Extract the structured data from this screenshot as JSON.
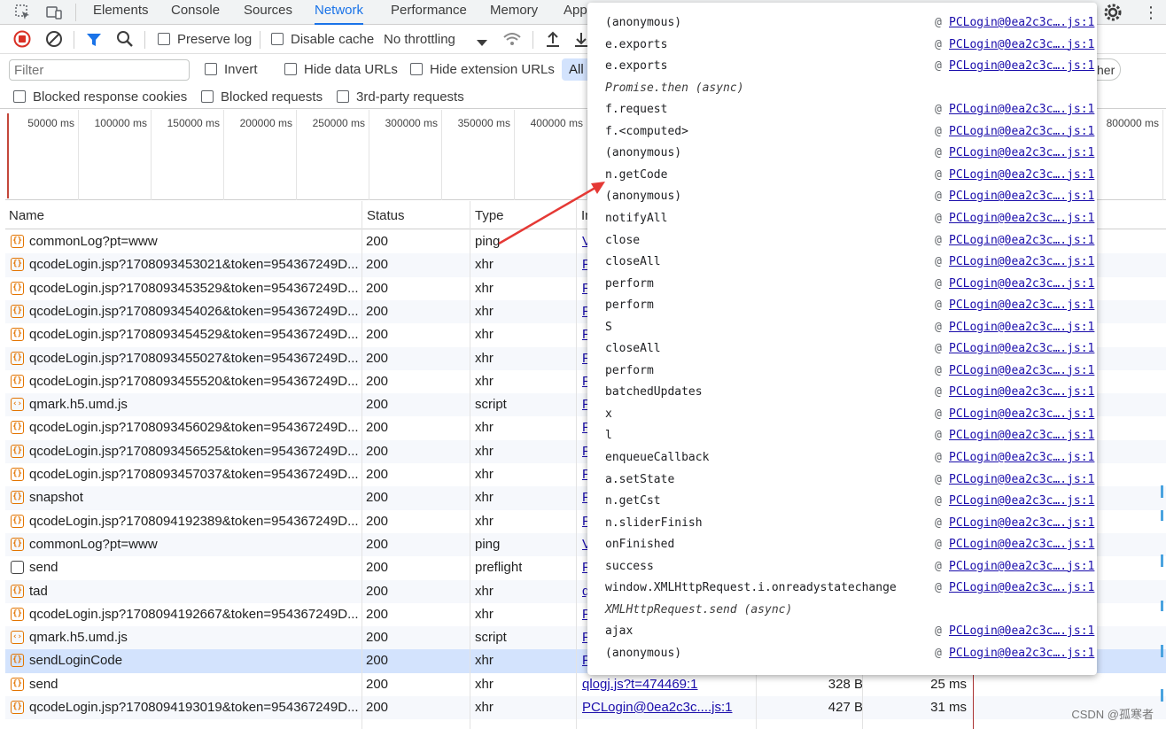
{
  "tabs": [
    {
      "label": "Elements",
      "active": false
    },
    {
      "label": "Console",
      "active": false
    },
    {
      "label": "Sources",
      "active": false
    },
    {
      "label": "Network",
      "active": true
    },
    {
      "label": "Performance",
      "active": false
    },
    {
      "label": "Memory",
      "active": false
    },
    {
      "label": "App",
      "active": false
    }
  ],
  "toolbar": {
    "preserve_log": "Preserve log",
    "disable_cache": "Disable cache",
    "throttling": "No throttling"
  },
  "filter": {
    "placeholder": "Filter",
    "invert": "Invert",
    "hide_data_urls": "Hide data URLs",
    "hide_extension_urls": "Hide extension URLs",
    "all": "All",
    "other_partial": "her"
  },
  "filter2": {
    "blocked_cookies": "Blocked response cookies",
    "blocked_requests": "Blocked requests",
    "third_party": "3rd-party requests"
  },
  "overview_ticks": [
    "50000 ms",
    "100000 ms",
    "150000 ms",
    "200000 ms",
    "250000 ms",
    "300000 ms",
    "350000 ms",
    "400000 ms",
    "800000 ms"
  ],
  "table": {
    "headers": {
      "name": "Name",
      "status": "Status",
      "type": "Type",
      "initiator": "In"
    },
    "rows": [
      {
        "icon": "xhr",
        "name": "commonLog?pt=www",
        "status": "200",
        "type": "ping",
        "initiator": "V",
        "size": "",
        "time": "",
        "alt": false,
        "sel": false
      },
      {
        "icon": "xhr",
        "name": "qcodeLogin.jsp?1708093453021&token=954367249D...",
        "status": "200",
        "type": "xhr",
        "initiator": "P",
        "size": "",
        "time": "",
        "alt": true,
        "sel": false
      },
      {
        "icon": "xhr",
        "name": "qcodeLogin.jsp?1708093453529&token=954367249D...",
        "status": "200",
        "type": "xhr",
        "initiator": "P",
        "size": "",
        "time": "",
        "alt": false,
        "sel": false
      },
      {
        "icon": "xhr",
        "name": "qcodeLogin.jsp?1708093454026&token=954367249D...",
        "status": "200",
        "type": "xhr",
        "initiator": "P",
        "size": "",
        "time": "",
        "alt": true,
        "sel": false
      },
      {
        "icon": "xhr",
        "name": "qcodeLogin.jsp?1708093454529&token=954367249D...",
        "status": "200",
        "type": "xhr",
        "initiator": "P",
        "size": "",
        "time": "",
        "alt": false,
        "sel": false
      },
      {
        "icon": "xhr",
        "name": "qcodeLogin.jsp?1708093455027&token=954367249D...",
        "status": "200",
        "type": "xhr",
        "initiator": "P",
        "size": "",
        "time": "",
        "alt": true,
        "sel": false
      },
      {
        "icon": "xhr",
        "name": "qcodeLogin.jsp?1708093455520&token=954367249D...",
        "status": "200",
        "type": "xhr",
        "initiator": "P",
        "size": "",
        "time": "",
        "alt": false,
        "sel": false
      },
      {
        "icon": "script",
        "name": "qmark.h5.umd.js",
        "status": "200",
        "type": "script",
        "initiator": "P",
        "size": "",
        "time": "",
        "alt": true,
        "sel": false
      },
      {
        "icon": "xhr",
        "name": "qcodeLogin.jsp?1708093456029&token=954367249D...",
        "status": "200",
        "type": "xhr",
        "initiator": "P",
        "size": "",
        "time": "",
        "alt": false,
        "sel": false
      },
      {
        "icon": "xhr",
        "name": "qcodeLogin.jsp?1708093456525&token=954367249D...",
        "status": "200",
        "type": "xhr",
        "initiator": "P",
        "size": "",
        "time": "",
        "alt": true,
        "sel": false
      },
      {
        "icon": "xhr",
        "name": "qcodeLogin.jsp?1708093457037&token=954367249D...",
        "status": "200",
        "type": "xhr",
        "initiator": "P",
        "size": "",
        "time": "",
        "alt": false,
        "sel": false
      },
      {
        "icon": "xhr",
        "name": "snapshot",
        "status": "200",
        "type": "xhr",
        "initiator": "P",
        "size": "",
        "time": "",
        "alt": true,
        "sel": false
      },
      {
        "icon": "xhr",
        "name": "qcodeLogin.jsp?1708094192389&token=954367249D...",
        "status": "200",
        "type": "xhr",
        "initiator": "P",
        "size": "",
        "time": "",
        "alt": false,
        "sel": false
      },
      {
        "icon": "xhr",
        "name": "commonLog?pt=www",
        "status": "200",
        "type": "ping",
        "initiator": "V",
        "size": "",
        "time": "",
        "alt": true,
        "sel": false
      },
      {
        "icon": "doc",
        "name": "send",
        "status": "200",
        "type": "preflight",
        "initiator": "P",
        "size": "",
        "time": "",
        "alt": false,
        "sel": false
      },
      {
        "icon": "xhr",
        "name": "tad",
        "status": "200",
        "type": "xhr",
        "initiator": "q",
        "size": "",
        "time": "",
        "alt": true,
        "sel": false
      },
      {
        "icon": "xhr",
        "name": "qcodeLogin.jsp?1708094192667&token=954367249D...",
        "status": "200",
        "type": "xhr",
        "initiator": "P",
        "size": "",
        "time": "",
        "alt": false,
        "sel": false
      },
      {
        "icon": "script",
        "name": "qmark.h5.umd.js",
        "status": "200",
        "type": "script",
        "initiator": "P",
        "size": "",
        "time": "",
        "alt": true,
        "sel": false
      },
      {
        "icon": "xhr",
        "name": "sendLoginCode",
        "status": "200",
        "type": "xhr",
        "initiator": "P",
        "size": "",
        "time": "",
        "alt": false,
        "sel": true
      },
      {
        "icon": "xhr",
        "name": "send",
        "status": "200",
        "type": "xhr",
        "initiator": "qlogj.js?t=474469:1",
        "size": "328 B",
        "time": "25 ms",
        "alt": false,
        "sel": false
      },
      {
        "icon": "xhr",
        "name": "qcodeLogin.jsp?1708094193019&token=954367249D...",
        "status": "200",
        "type": "xhr",
        "initiator": "PCLogin@0ea2c3c....js:1",
        "size": "427 B",
        "time": "31 ms",
        "alt": true,
        "sel": false
      }
    ]
  },
  "callstack": [
    {
      "fn": "(anonymous)",
      "src": "PCLogin@0ea2c3c….js:1",
      "async": false
    },
    {
      "fn": "e.exports",
      "src": "PCLogin@0ea2c3c….js:1",
      "async": false
    },
    {
      "fn": "e.exports",
      "src": "PCLogin@0ea2c3c….js:1",
      "async": false
    },
    {
      "fn": "Promise.then (async)",
      "src": "",
      "async": true
    },
    {
      "fn": "f.request",
      "src": "PCLogin@0ea2c3c….js:1",
      "async": false
    },
    {
      "fn": "f.<computed>",
      "src": "PCLogin@0ea2c3c….js:1",
      "async": false
    },
    {
      "fn": "(anonymous)",
      "src": "PCLogin@0ea2c3c….js:1",
      "async": false
    },
    {
      "fn": "n.getCode",
      "src": "PCLogin@0ea2c3c….js:1",
      "async": false
    },
    {
      "fn": "(anonymous)",
      "src": "PCLogin@0ea2c3c….js:1",
      "async": false
    },
    {
      "fn": "notifyAll",
      "src": "PCLogin@0ea2c3c….js:1",
      "async": false
    },
    {
      "fn": "close",
      "src": "PCLogin@0ea2c3c….js:1",
      "async": false
    },
    {
      "fn": "closeAll",
      "src": "PCLogin@0ea2c3c….js:1",
      "async": false
    },
    {
      "fn": "perform",
      "src": "PCLogin@0ea2c3c….js:1",
      "async": false
    },
    {
      "fn": "perform",
      "src": "PCLogin@0ea2c3c….js:1",
      "async": false
    },
    {
      "fn": "S",
      "src": "PCLogin@0ea2c3c….js:1",
      "async": false
    },
    {
      "fn": "closeAll",
      "src": "PCLogin@0ea2c3c….js:1",
      "async": false
    },
    {
      "fn": "perform",
      "src": "PCLogin@0ea2c3c….js:1",
      "async": false
    },
    {
      "fn": "batchedUpdates",
      "src": "PCLogin@0ea2c3c….js:1",
      "async": false
    },
    {
      "fn": "x",
      "src": "PCLogin@0ea2c3c….js:1",
      "async": false
    },
    {
      "fn": "l",
      "src": "PCLogin@0ea2c3c….js:1",
      "async": false
    },
    {
      "fn": "enqueueCallback",
      "src": "PCLogin@0ea2c3c….js:1",
      "async": false
    },
    {
      "fn": "a.setState",
      "src": "PCLogin@0ea2c3c….js:1",
      "async": false
    },
    {
      "fn": "n.getCst",
      "src": "PCLogin@0ea2c3c….js:1",
      "async": false
    },
    {
      "fn": "n.sliderFinish",
      "src": "PCLogin@0ea2c3c….js:1",
      "async": false
    },
    {
      "fn": "onFinished",
      "src": "PCLogin@0ea2c3c….js:1",
      "async": false
    },
    {
      "fn": "success",
      "src": "PCLogin@0ea2c3c….js:1",
      "async": false
    },
    {
      "fn": "window.XMLHttpRequest.i.onreadystatechange",
      "src": "PCLogin@0ea2c3c….js:1",
      "async": false
    },
    {
      "fn": "XMLHttpRequest.send (async)",
      "src": "",
      "async": true
    },
    {
      "fn": "ajax",
      "src": "PCLogin@0ea2c3c….js:1",
      "async": false
    },
    {
      "fn": "(anonymous)",
      "src": "PCLogin@0ea2c3c….js:1",
      "async": false
    }
  ],
  "at_symbol": "@",
  "watermark": "CSDN @孤寒者",
  "colors": {
    "accent": "#1a73e8",
    "record": "#d93025",
    "selected_row": "#d3e3fd",
    "arrow": "#e53935"
  }
}
